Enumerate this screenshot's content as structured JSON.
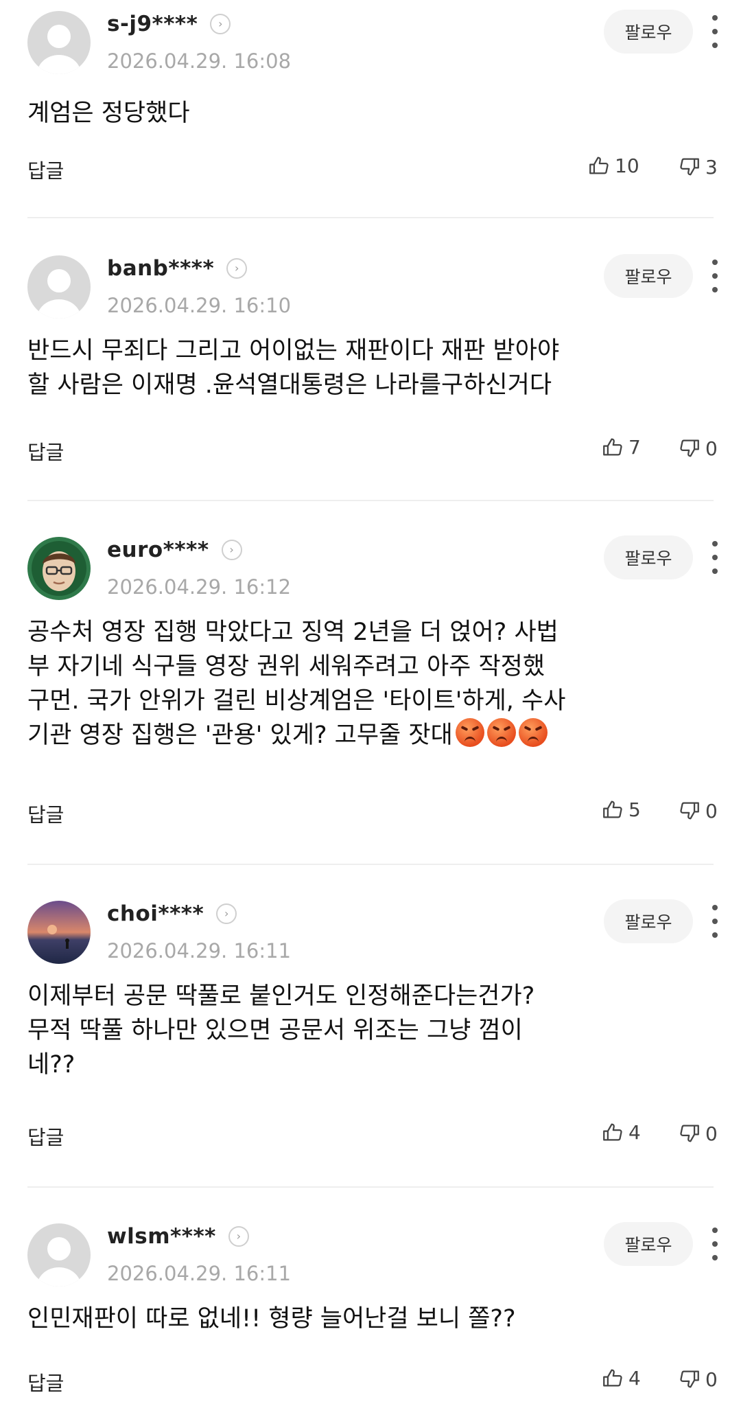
{
  "comments": [
    {
      "username": "s-j9****",
      "timestamp": "2026.04.29. 16:08",
      "follow_label": "팔로우",
      "text": "계엄은 정당했다",
      "reply_label": "답글",
      "likes": "10",
      "dislikes": "3",
      "avatar": "default-avatar"
    },
    {
      "username": "banb****",
      "timestamp": "2026.04.29. 16:10",
      "follow_label": "팔로우",
      "text": "반드시 무죄다 그리고 어이없는 재판이다 재판 받아야\n할 사람은 이재명 .윤석열대통령은 나라를구하신거다",
      "reply_label": "답글",
      "likes": "7",
      "dislikes": "0",
      "avatar": "default-avatar"
    },
    {
      "username": "euro****",
      "timestamp": "2026.04.29. 16:12",
      "follow_label": "팔로우",
      "text": "공수처 영장 집행 막았다고 징역 2년을 더 얹어? 사법\n부 자기네 식구들 영장 권위 세워주려고 아주 작정했\n구먼. 국가 안위가 걸린 비상계엄은 '타이트'하게, 수사\n기관 영장 집행은 '관용' 있게? 고무줄 잣대",
      "emoji_count": 3,
      "reply_label": "답글",
      "likes": "5",
      "dislikes": "0",
      "avatar": "glasses-face-avatar"
    },
    {
      "username": "choi****",
      "timestamp": "2026.04.29. 16:11",
      "follow_label": "팔로우",
      "text": "이제부터 공문 딱풀로 붙인거도 인정해준다는건가?\n무적 딱풀 하나만 있으면 공문서 위조는 그냥 껌이\n네??",
      "reply_label": "답글",
      "likes": "4",
      "dislikes": "0",
      "avatar": "sunset-sea-avatar"
    },
    {
      "username": "wlsm****",
      "timestamp": "2026.04.29. 16:11",
      "follow_label": "팔로우",
      "text": "인민재판이 따로 없네!! 형량 늘어난걸 보니 쫄??",
      "reply_label": "답글",
      "likes": "4",
      "dislikes": "0",
      "avatar": "default-avatar"
    }
  ],
  "colors": {
    "background": "#ffffff",
    "divider": "#eeeeee",
    "follow_button_bg": "#f4f4f4",
    "timestamp": "#a8a8a8",
    "emoji": "#e84e1f"
  }
}
